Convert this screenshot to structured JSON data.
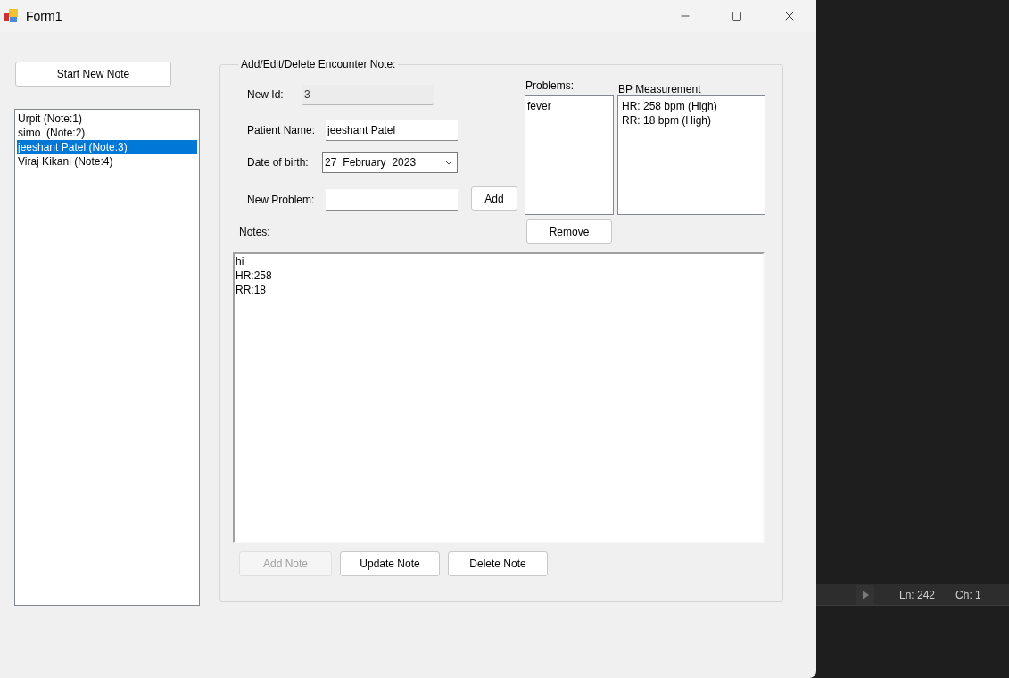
{
  "window": {
    "title": "Form1"
  },
  "start_button": "Start New Note",
  "notes_list": [
    {
      "label": "Urpit (Note:1)",
      "selected": false
    },
    {
      "label": "simo  (Note:2)",
      "selected": false
    },
    {
      "label": "jeeshant Patel (Note:3)",
      "selected": true
    },
    {
      "label": "Viraj Kikani (Note:4)",
      "selected": false
    }
  ],
  "form": {
    "legend": "Add/Edit/Delete Encounter Note:",
    "id_field": {
      "label": "New Id:",
      "value": "3",
      "disabled": true
    },
    "name_field": {
      "label": "Patient Name:",
      "value": "jeeshant Patel"
    },
    "dob_field": {
      "label": "Date of birth:",
      "day": "27",
      "month": "February",
      "year": "2023"
    },
    "problem_field": {
      "label": "New Problem:"
    },
    "add_button": "Add",
    "problems": {
      "label": "Problems:",
      "items": [
        "fever"
      ]
    },
    "remove_button": "Remove",
    "bp": {
      "label": "BP Measurement",
      "items": [
        "HR: 258 bpm (High)",
        "RR: 18 bpm (High)"
      ]
    },
    "notes": {
      "label": "Notes:",
      "lines": [
        "hi",
        "HR:258",
        "RR:18"
      ]
    },
    "actions": [
      {
        "label": "Add Note",
        "disabled": true
      },
      {
        "label": "Update Note",
        "disabled": false
      },
      {
        "label": "Delete Note",
        "disabled": false
      }
    ]
  },
  "editor_status": {
    "line": "Ln: 242",
    "column": "Ch: 1"
  }
}
